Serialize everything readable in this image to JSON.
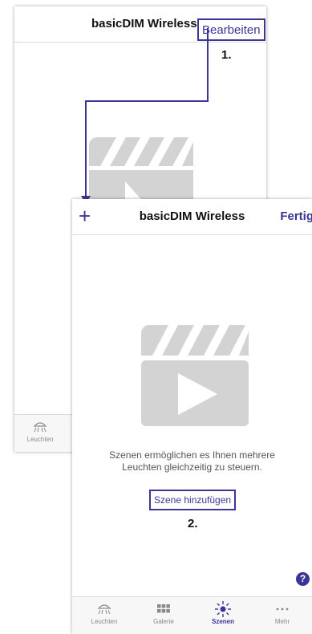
{
  "screen1": {
    "title": "basicDIM Wireless",
    "edit_label": "Bearbeiten",
    "step_label": "1.",
    "tabs": [
      {
        "label": "Leuchten",
        "icon": "lamp-icon"
      }
    ]
  },
  "screen2": {
    "title": "basicDIM Wireless",
    "add_label": "+",
    "done_label": "Fertig",
    "empty_text": "Szenen ermöglichen es Ihnen mehrere Leuchten gleichzeitig zu steuern.",
    "add_scene_label": "Szene hinzufügen",
    "step_label": "2.",
    "help_label": "?",
    "tabs": [
      {
        "label": "Leuchten",
        "icon": "lamp-icon"
      },
      {
        "label": "Galerie",
        "icon": "grid-icon"
      },
      {
        "label": "Szenen",
        "icon": "sun-icon",
        "active": true
      },
      {
        "label": "Mehr",
        "icon": "more-icon"
      }
    ]
  },
  "colors": {
    "accent": "#3b3597",
    "placeholder": "#d3d3d3"
  }
}
